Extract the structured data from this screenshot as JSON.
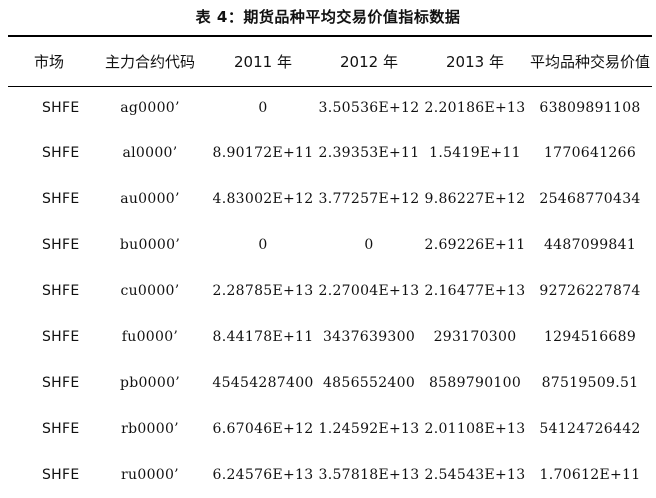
{
  "title": "表 4：期货品种平均交易价值指标数据",
  "table": {
    "headers": [
      "市场",
      "主力合约代码",
      "2011 年",
      "2012 年",
      "2013 年",
      "平均品种交易价值"
    ],
    "rows": [
      [
        "SHFE",
        "ag0000’",
        "0",
        "3.50536E+12",
        "2.20186E+13",
        "63809891108"
      ],
      [
        "SHFE",
        "al0000’",
        "8.90172E+11",
        "2.39353E+11",
        "1.5419E+11",
        "1770641266"
      ],
      [
        "SHFE",
        "au0000’",
        "4.83002E+12",
        "3.77257E+12",
        "9.86227E+12",
        "25468770434"
      ],
      [
        "SHFE",
        "bu0000’",
        "0",
        "0",
        "2.69226E+11",
        "4487099841"
      ],
      [
        "SHFE",
        "cu0000’",
        "2.28785E+13",
        "2.27004E+13",
        "2.16477E+13",
        "92726227874"
      ],
      [
        "SHFE",
        "fu0000’",
        "8.44178E+11",
        "3437639300",
        "293170300",
        "1294516689"
      ],
      [
        "SHFE",
        "pb0000’",
        "45454287400",
        "4856552400",
        "8589790100",
        "87519509.51"
      ],
      [
        "SHFE",
        "rb0000’",
        "6.67046E+12",
        "1.24592E+13",
        "2.01108E+13",
        "54124726442"
      ],
      [
        "SHFE",
        "ru0000’",
        "6.24576E+13",
        "3.57818E+13",
        "2.54543E+13",
        "1.70612E+11"
      ]
    ]
  }
}
